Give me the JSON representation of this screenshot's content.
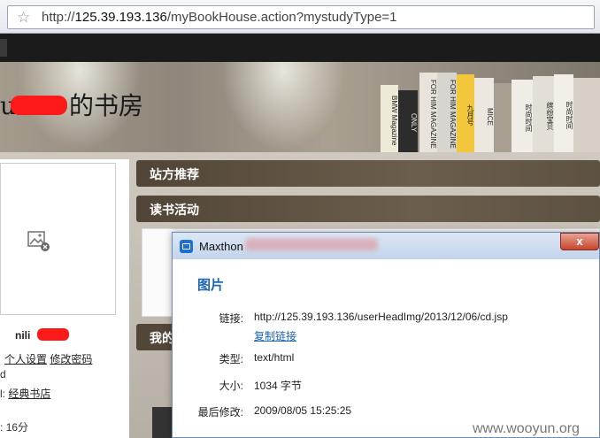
{
  "browser": {
    "url_prefix": "http://",
    "url_host": "125.39.193.136",
    "url_path": "/myBookHouse.action?mystudyType=1"
  },
  "banner": {
    "title_prefix": "u",
    "title_suffix": "的书房",
    "books": [
      "BMW Magazine",
      "ONLY",
      "FOR HIM MAGAZINE",
      "FOR HIM MAGAZINE",
      "九月号",
      "MICE",
      "时尚时间",
      "缤纷宝贝",
      "时尚时间"
    ]
  },
  "sidebar": {
    "username": "nili",
    "links": [
      "个人设置",
      "修改密码"
    ],
    "line_d": "d",
    "store_label": "l:",
    "store_link": "经典书店",
    "points_label": ":",
    "points_value": "16分"
  },
  "sections": [
    {
      "label": "站方推荐"
    },
    {
      "label": "读书活动"
    },
    {
      "label": "我的"
    }
  ],
  "dialog": {
    "title": "Maxthon",
    "close_glyph": "x",
    "heading": "图片",
    "rows": {
      "link_label": "链接:",
      "link_value": "http://125.39.193.136/userHeadImg/2013/12/06/cd.jsp",
      "copy_link": "复制链接",
      "type_label": "类型:",
      "type_value": "text/html",
      "size_label": "大小:",
      "size_value": "1034 字节",
      "modified_label": "最后修改:",
      "modified_value": "2009/08/05 15:25:25"
    }
  },
  "watermark": "www.wooyun.org",
  "colors": {
    "accent_blue": "#1e64b4",
    "section_bar": "#514537",
    "redaction_red": "#ff1a1a"
  }
}
